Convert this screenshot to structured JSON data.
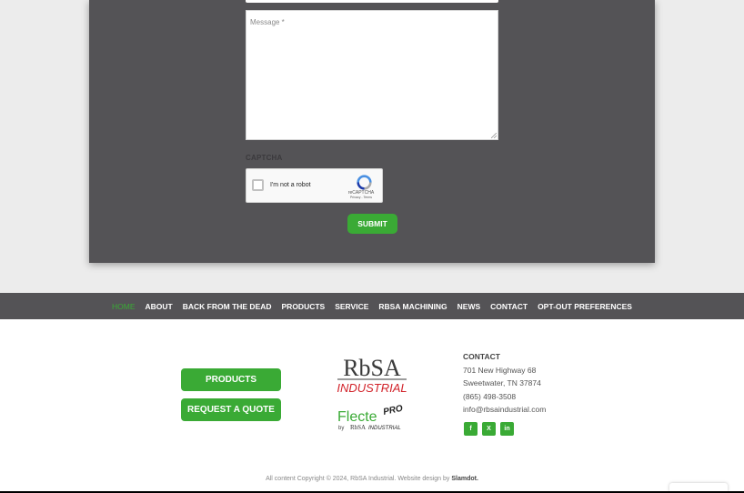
{
  "form": {
    "message_placeholder": "Message *",
    "captcha_label": "CAPTCHA",
    "recaptcha_checkbox_text": "I'm not a robot",
    "recaptcha_brand": "reCAPTCHA",
    "recaptcha_links": "Privacy - Terms",
    "submit_label": "SUBMIT"
  },
  "nav": {
    "items": [
      {
        "label": "HOME",
        "active": true
      },
      {
        "label": "ABOUT"
      },
      {
        "label": "BACK FROM THE DEAD"
      },
      {
        "label": "PRODUCTS"
      },
      {
        "label": "SERVICE"
      },
      {
        "label": "RBSA MACHINING"
      },
      {
        "label": "NEWS"
      },
      {
        "label": "CONTACT"
      },
      {
        "label": "OPT-OUT PREFERENCES"
      }
    ]
  },
  "footer": {
    "buttons": {
      "products": "PRODUCTS",
      "quote": "REQUEST A QUOTE"
    },
    "logo_rbsa": {
      "top": "RbSA",
      "bottom": "INDUSTRIAL"
    },
    "logo_flecte": {
      "main": "Flecte",
      "sup": "PRO",
      "by": "by",
      "brand": "RbSA",
      "industrial": "INDUSTRIAL"
    },
    "contact": {
      "heading": "CONTACT",
      "address1": "701 New Highway 68",
      "address2": "Sweetwater, TN 37874",
      "phone": "(865) 498-3508",
      "email": "info@rbsaindustrial.com"
    },
    "social": [
      {
        "icon": "facebook-icon",
        "glyph": "f"
      },
      {
        "icon": "x-twitter-icon",
        "glyph": "X"
      },
      {
        "icon": "linkedin-icon",
        "glyph": "in"
      }
    ],
    "copyright_text": "All content Copyright © 2024, RbSA Industrial. Website design by ",
    "copyright_link": "Slamdot."
  },
  "colors": {
    "accent": "#3aaa35",
    "dark": "#545356",
    "logo_red": "#d2232a"
  }
}
